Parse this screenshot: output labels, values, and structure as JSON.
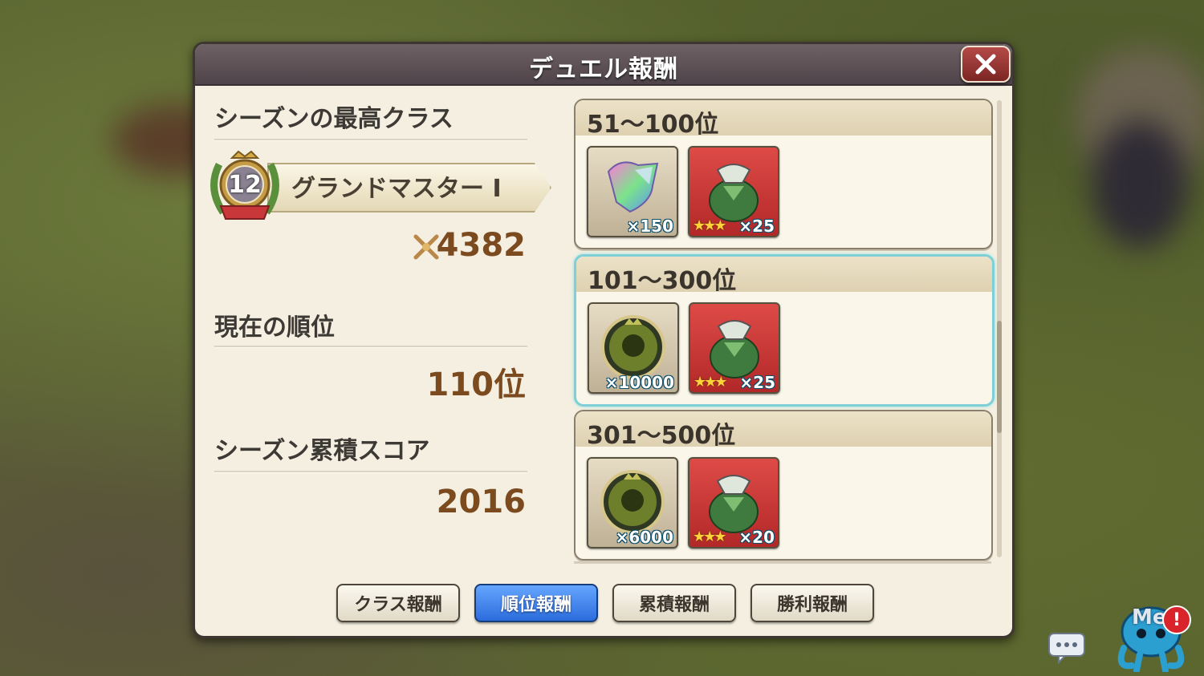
{
  "dialog": {
    "title": "デュエル報酬"
  },
  "left": {
    "best_class_label": "シーズンの最高クラス",
    "badge_level": "12",
    "class_name": "グランドマスター I",
    "rating": "4382",
    "current_rank_label": "現在の順位",
    "current_rank": "110位",
    "season_score_label": "シーズン累積スコア",
    "season_score": "2016"
  },
  "ranks": [
    {
      "label": "51〜100位",
      "selected": false,
      "rewards": [
        {
          "icon": "rainbow-crystal-icon",
          "qty": "×150",
          "stars": ""
        },
        {
          "icon": "green-pouch-icon",
          "qty": "×25",
          "stars": "★★★"
        }
      ]
    },
    {
      "label": "101〜300位",
      "selected": true,
      "rewards": [
        {
          "icon": "green-medal-icon",
          "qty": "×10000",
          "stars": ""
        },
        {
          "icon": "green-pouch-icon",
          "qty": "×25",
          "stars": "★★★"
        }
      ]
    },
    {
      "label": "301〜500位",
      "selected": false,
      "rewards": [
        {
          "icon": "green-medal-icon",
          "qty": "×6000",
          "stars": ""
        },
        {
          "icon": "green-pouch-icon",
          "qty": "×20",
          "stars": "★★★"
        }
      ]
    }
  ],
  "tabs": [
    {
      "label": "クラス報酬",
      "active": false
    },
    {
      "label": "順位報酬",
      "active": true
    },
    {
      "label": "累積報酬",
      "active": false
    },
    {
      "label": "勝利報酬",
      "active": false
    }
  ],
  "overlay": {
    "me_text": "Me",
    "alert": "!"
  },
  "colors": {
    "title_bar": "#5e5257",
    "panel": "#f4efe0",
    "active_tab": "#3a7de8",
    "selected_card_border": "#7fcfd6",
    "value_text": "#7b4a1e"
  }
}
